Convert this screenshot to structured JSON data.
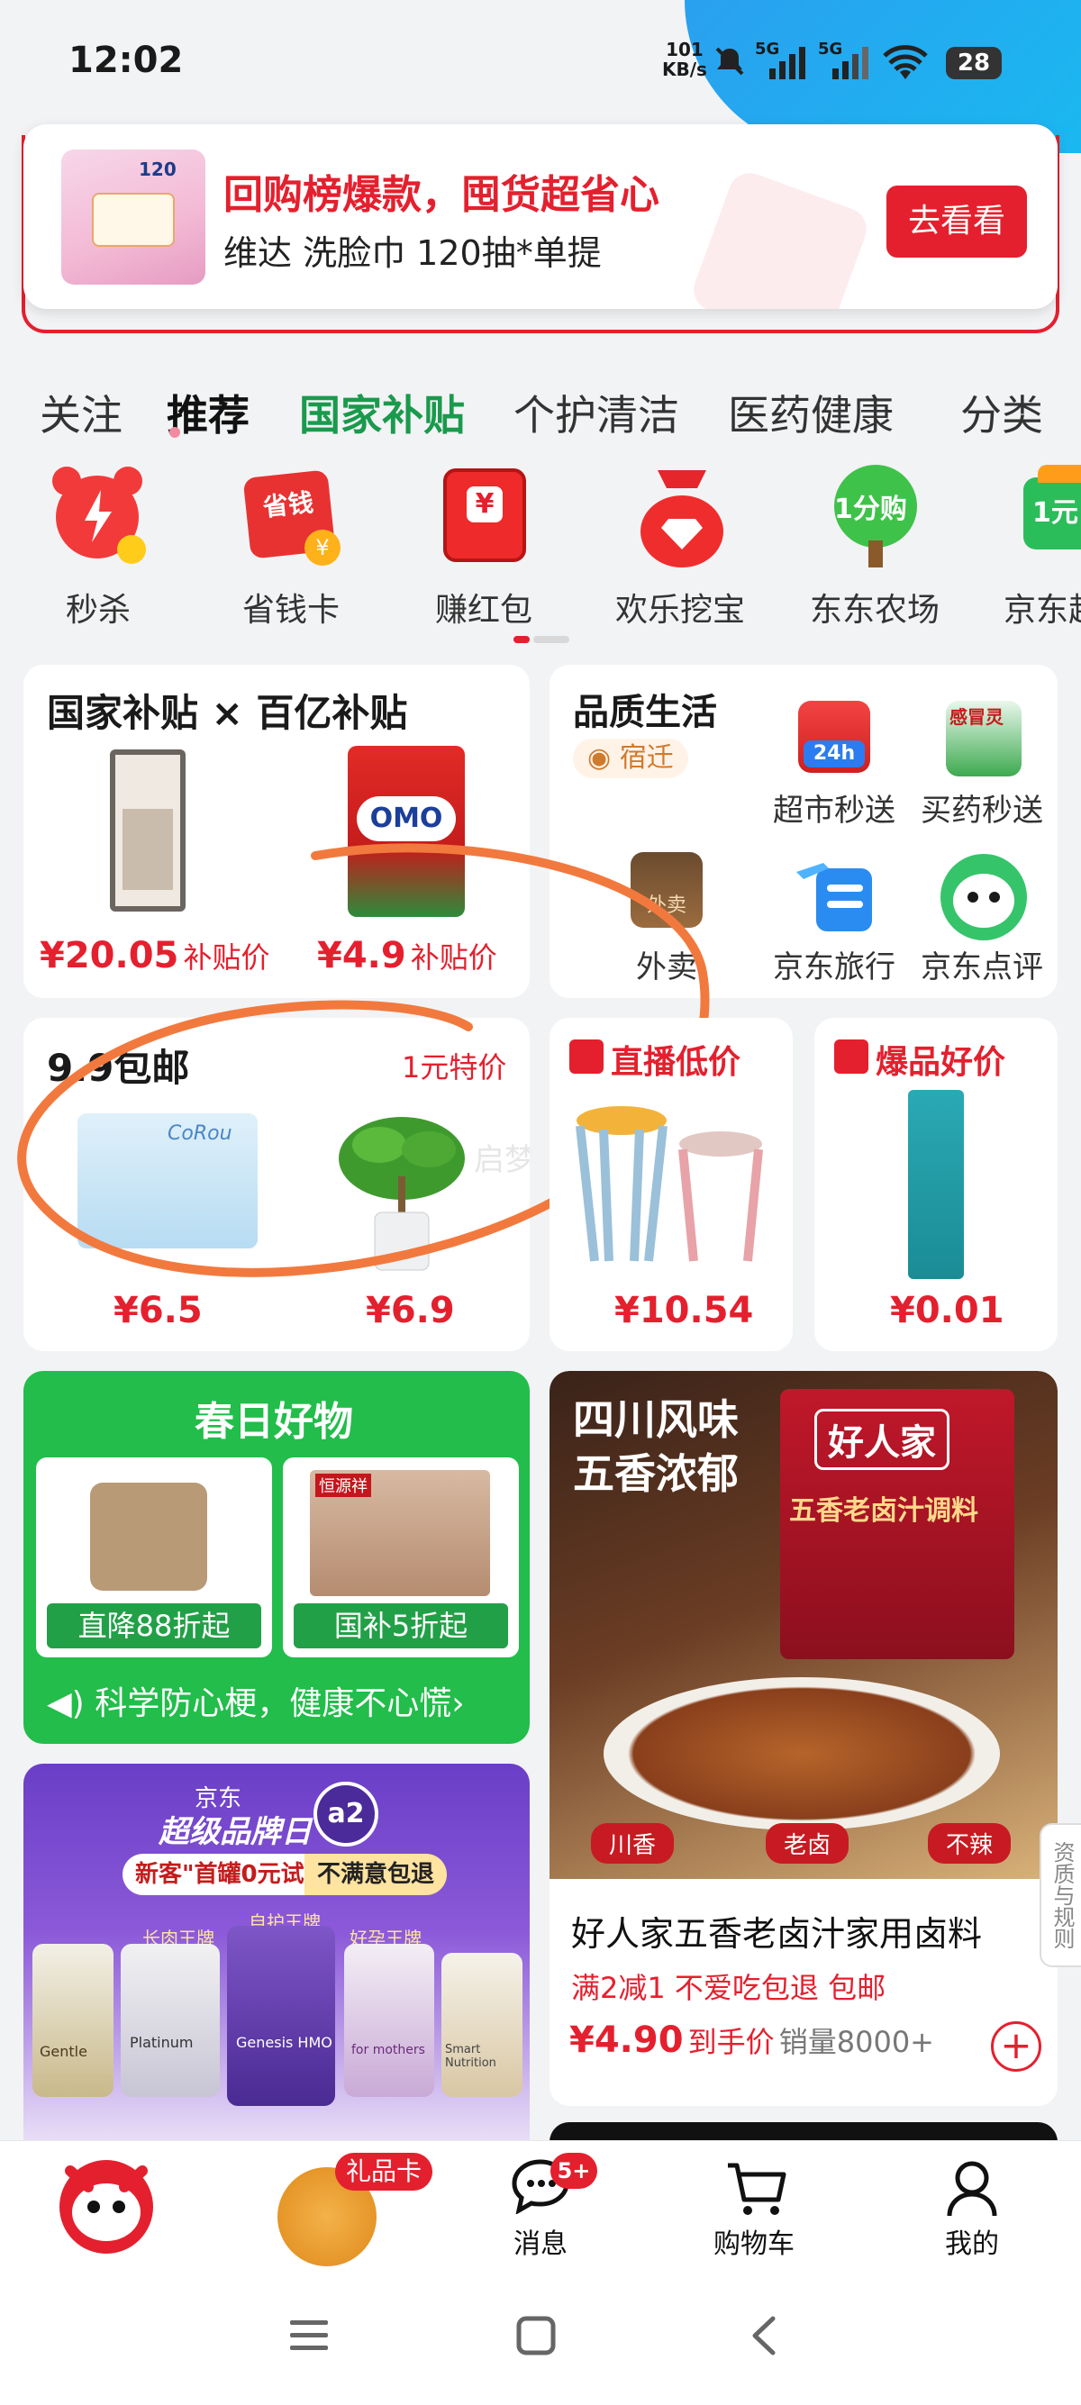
{
  "status_bar": {
    "time": "12:02",
    "net_speed_top": "101",
    "net_speed_bottom": "KB/s",
    "signal1": "5G",
    "signal2": "5G",
    "battery": "28"
  },
  "promo_banner": {
    "product_badge": "120",
    "title": "回购榜爆款，囤货超省心",
    "subtitle": "维达 洗脸巾 120抽*单提",
    "button": "去看看"
  },
  "tabs": [
    {
      "label": "关注"
    },
    {
      "label": "推荐"
    },
    {
      "label": "国家补贴"
    },
    {
      "label": "个护清洁"
    },
    {
      "label": "医药健康"
    },
    {
      "label": "分类"
    }
  ],
  "quick_icons": [
    {
      "label": "秒杀",
      "icon": "alarm-clock-icon"
    },
    {
      "label": "省钱卡",
      "icon": "money-card-icon",
      "text": "省钱",
      "coin": "¥"
    },
    {
      "label": "赚红包",
      "icon": "red-envelope-icon",
      "text": "¥"
    },
    {
      "label": "欢乐挖宝",
      "icon": "treasure-bag-icon"
    },
    {
      "label": "东东农场",
      "icon": "tree-icon",
      "text": "1分购"
    },
    {
      "label": "京东超",
      "icon": "supermarket-icon",
      "text": "1元"
    }
  ],
  "subsidy_card": {
    "title": "国家补贴 × 百亿补贴",
    "items": [
      {
        "price": "¥20.05",
        "price_label": "补贴价"
      },
      {
        "price": "¥4.9",
        "price_label": "补贴价",
        "brand": "OMO"
      }
    ]
  },
  "quality_card": {
    "title": "品质生活",
    "location": "宿迁",
    "services": [
      {
        "label": "超市秒送",
        "badge": "24h"
      },
      {
        "label": "买药秒送",
        "badge": "感冒灵"
      },
      {
        "label": "外卖",
        "badge": "外卖"
      },
      {
        "label": "京东旅行"
      },
      {
        "label": "京东点评"
      }
    ]
  },
  "deal_card": {
    "title": "9.9包邮",
    "subtitle": "1元特价",
    "watermark": "启梦",
    "brand": "CoRou",
    "items": [
      {
        "price": "¥6.5"
      },
      {
        "price": "¥6.9"
      }
    ]
  },
  "live_card": {
    "title": "直播低价",
    "price": "¥10.54"
  },
  "hot_card": {
    "title": "爆品好价",
    "price": "¥0.01"
  },
  "spring_card": {
    "title": "春日好物",
    "items": [
      {
        "tag": "直降88折起"
      },
      {
        "tag": "国补5折起",
        "badge": "恒源祥"
      }
    ],
    "notice": "科学防心梗，健康不心慌",
    "notice_arrow": "›"
  },
  "brand_banner": {
    "top": "京东",
    "headline": "超级品牌日",
    "promo1": "新客\"首罐0元试\"",
    "promo2": "不满意包退",
    "label1": "长肉王牌",
    "label2": "自护王牌",
    "label3": "好孕王牌",
    "logo": "a2",
    "cans": [
      "Gentle",
      "Platinum",
      "Genesis HMO",
      "for mothers",
      "Smart Nutrition"
    ]
  },
  "product_card": {
    "image_title_line1": "四川风味",
    "image_title_line2": "五香浓郁",
    "brand": "好人家",
    "pack_text": "五香老卤汁调料",
    "tags": [
      "川香",
      "老卤",
      "不辣"
    ],
    "name": "好人家五香老卤汁家用卤料",
    "promo": "满2减1 不爱吃包退 包邮",
    "price": "¥4.90",
    "price_label": "到手价",
    "sales": "销量8000+",
    "add": "+"
  },
  "side_tab": "资质与规则",
  "bottom_nav": [
    {
      "label": "",
      "icon": "jd-mascot-icon"
    },
    {
      "label": "",
      "icon": "gift-card-icon",
      "badge": "礼品卡"
    },
    {
      "label": "消息",
      "icon": "message-icon",
      "badge": "5+"
    },
    {
      "label": "购物车",
      "icon": "cart-icon"
    },
    {
      "label": "我的",
      "icon": "user-icon"
    }
  ],
  "system_nav": [
    "menu-icon",
    "home-icon",
    "back-icon"
  ],
  "colors": {
    "brand_red": "#e4202e",
    "green": "#1fa34a",
    "tab_active": "#1a9a4c"
  }
}
